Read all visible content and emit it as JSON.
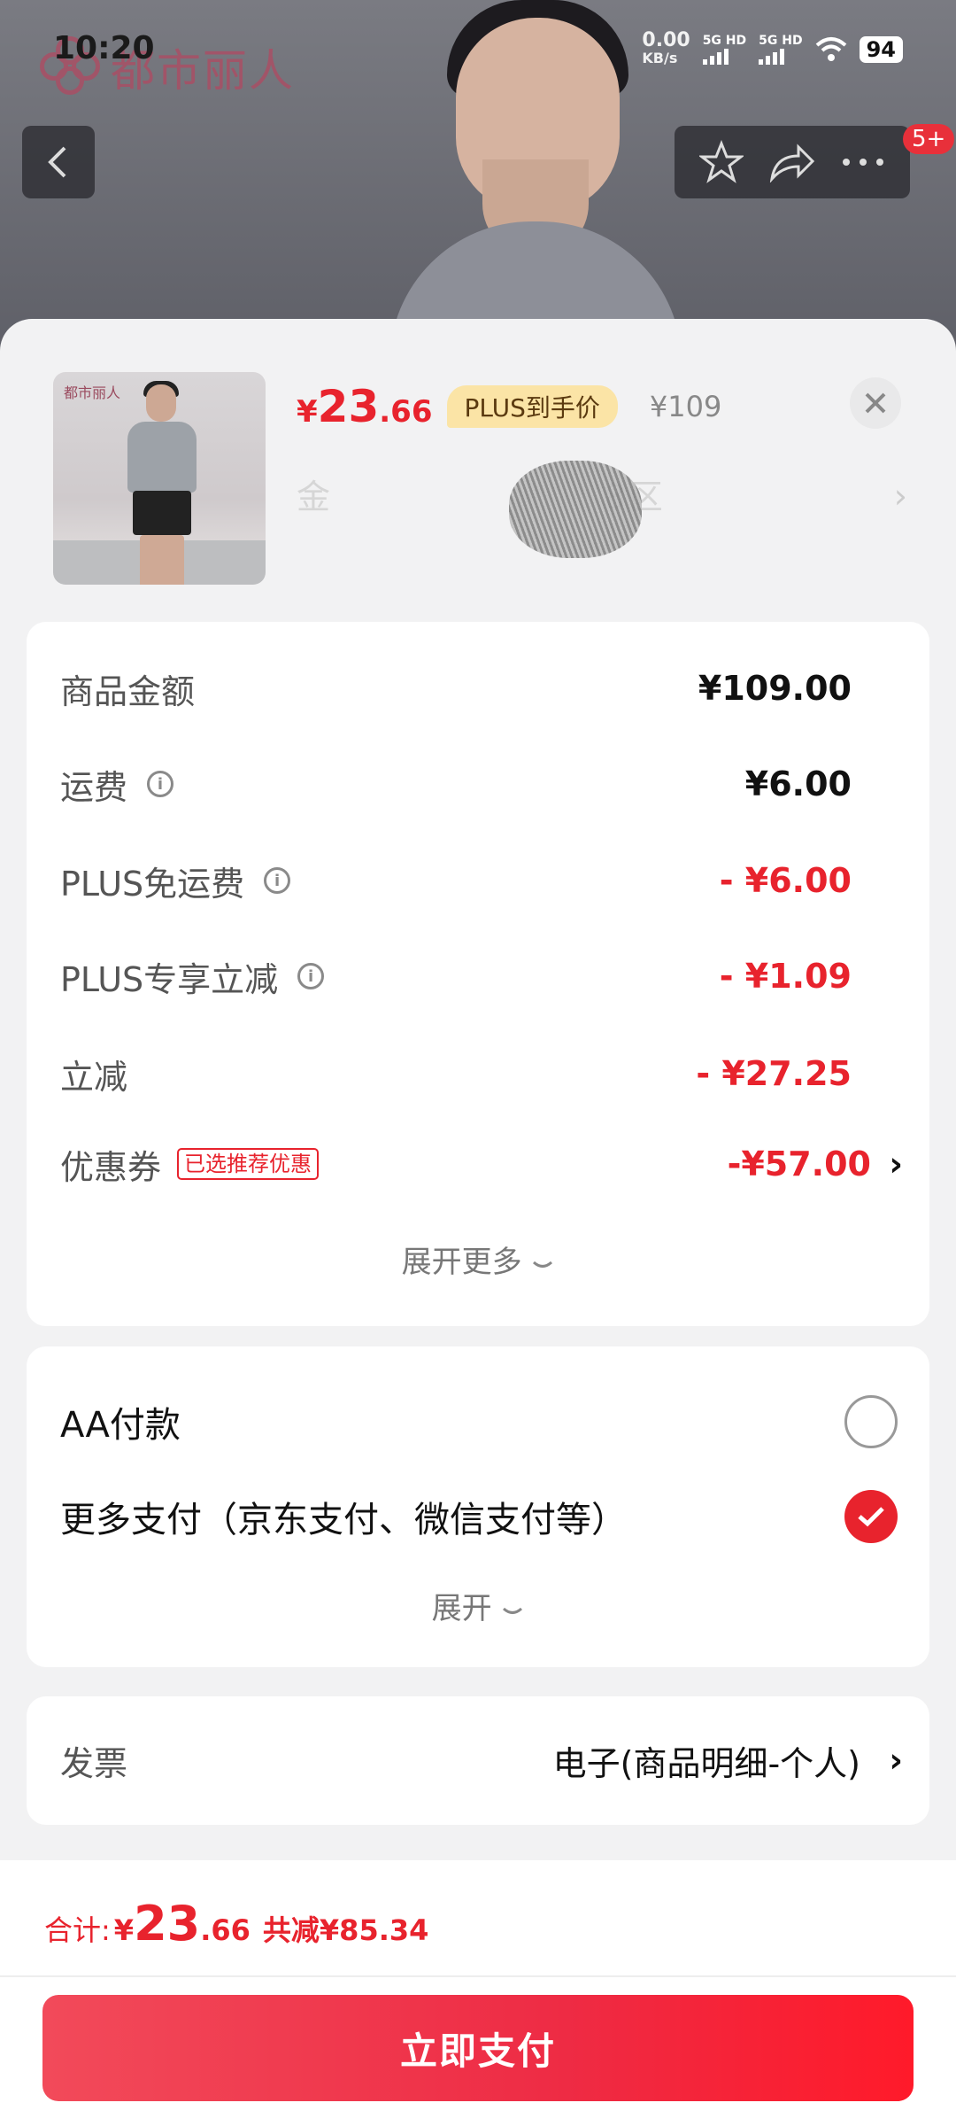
{
  "status_bar": {
    "time": "10:20",
    "net_speed": "0.00",
    "net_unit": "KB/s",
    "sim1": "5G HD",
    "sim2": "5G HD",
    "battery": "94"
  },
  "background": {
    "brand_logo_text": "都市丽人",
    "cart_badge": "5+"
  },
  "product": {
    "thumb_logo": "都市丽人",
    "price_currency": "¥",
    "price_int": "23",
    "price_dec": ".66",
    "plus_tag": "PLUS到手价",
    "original_price": "¥109",
    "address_visible_tail": "8区"
  },
  "summary": {
    "rows": [
      {
        "label": "商品金额",
        "value": "¥109.00"
      },
      {
        "label": "运费",
        "value": "¥6.00"
      },
      {
        "label": "PLUS免运费",
        "value": "- ¥6.00"
      },
      {
        "label": "PLUS专享立减",
        "value": "- ¥1.09"
      },
      {
        "label": "立减",
        "value": "- ¥27.25"
      },
      {
        "label": "优惠券",
        "value": "-¥57.00"
      }
    ],
    "coupon_tag": "已选推荐优惠",
    "expand_more": "展开更多"
  },
  "payment": {
    "options": [
      {
        "label": "AA付款",
        "selected": false
      },
      {
        "label": "更多支付（京东支付、微信支付等）",
        "selected": true
      }
    ],
    "expand": "展开"
  },
  "invoice": {
    "label": "发票",
    "value": "电子(商品明细-个人)"
  },
  "footer": {
    "total_label": "合计:",
    "total_currency": "¥",
    "total_int": "23",
    "total_dec": ".66",
    "saved": "共减¥85.34",
    "pay_button": "立即支付"
  },
  "colors": {
    "accent": "#e8232d",
    "plus_tag_bg": "#fbe4a6",
    "sheet_bg": "#f2f2f3"
  },
  "icons": [
    "back-icon",
    "star-icon",
    "share-icon",
    "more-icon",
    "close-icon",
    "info-icon",
    "chevron-right-icon",
    "chevron-down-icon",
    "check-icon",
    "wifi-icon"
  ]
}
